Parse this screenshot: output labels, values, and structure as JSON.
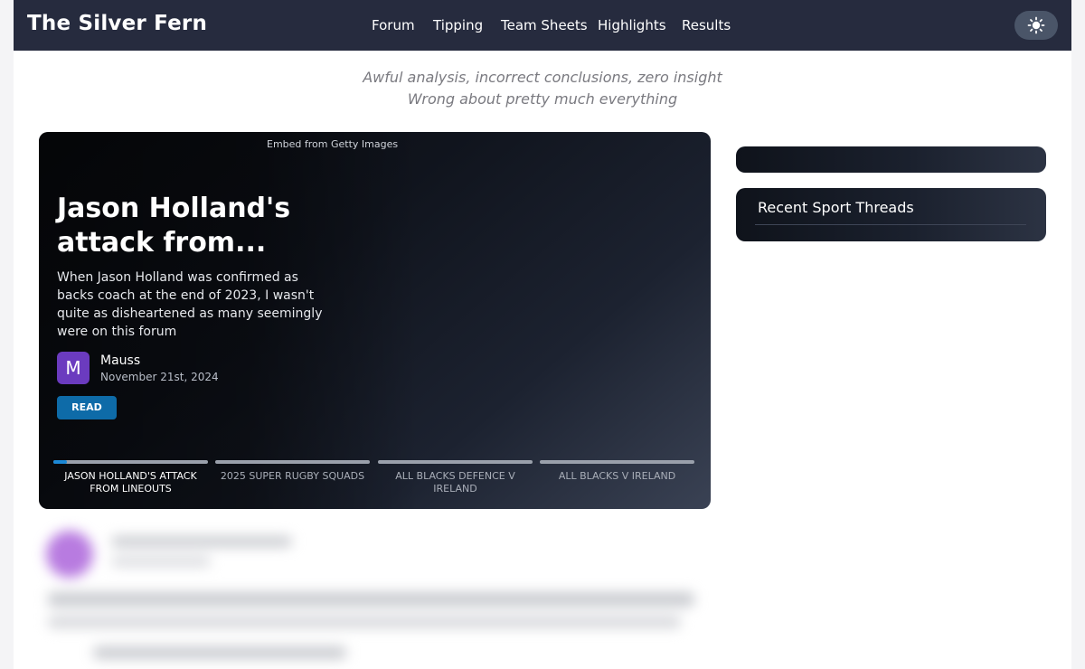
{
  "nav": {
    "brand": "The Silver Fern",
    "links": [
      "Forum",
      "Tipping",
      "Team Sheets",
      "Highlights",
      "Results"
    ],
    "theme_icon": "sun-icon"
  },
  "tagline": {
    "line1": "Awful analysis, incorrect conclusions, zero insight",
    "line2": "Wrong about pretty much everything"
  },
  "hero": {
    "embed_label": "Embed from Getty Images",
    "title": "Jason Holland's attack from...",
    "excerpt": "When Jason Holland was confirmed as backs coach at the end of 2023, I wasn't quite as disheartened as many seemingly were on this forum",
    "author_initial": "M",
    "author_name": "Mauss",
    "date": "November 21st, 2024",
    "read_label": "READ",
    "tabs": [
      {
        "label": "JASON HOLLAND'S ATTACK FROM LINEOUTS",
        "active": true
      },
      {
        "label": "2025 SUPER RUGBY SQUADS",
        "active": false
      },
      {
        "label": "ALL BLACKS DEFENCE V IRELAND",
        "active": false
      },
      {
        "label": "ALL BLACKS V IRELAND",
        "active": false
      }
    ],
    "active_progress": 0.09
  },
  "sidebar": {
    "recent_title": "Recent Sport Threads"
  },
  "colors": {
    "nav_bg": "#262b3e",
    "accent": "#0e6ba8",
    "avatar": "#6b3bbf"
  }
}
